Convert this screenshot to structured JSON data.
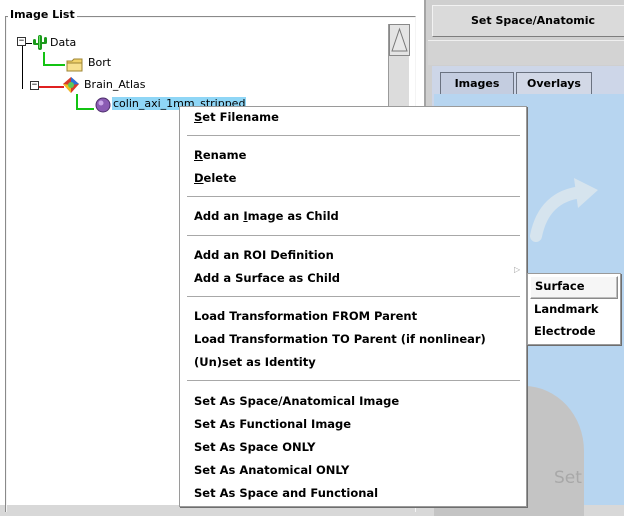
{
  "image_list": {
    "title": "Image List",
    "tree": {
      "root": "Data",
      "children": [
        {
          "label": "Bort"
        },
        {
          "label": "Brain_Atlas",
          "children": [
            {
              "label": "colin_axi_1mm_stripped"
            }
          ]
        }
      ]
    }
  },
  "right_panel": {
    "set_space_button": "Set Space/Anatomic",
    "tabs": [
      "Images",
      "Overlays"
    ],
    "viewer_text": "Set"
  },
  "context_menu": {
    "items": [
      {
        "label": "Set Filename",
        "accel": "S"
      },
      {
        "label": "Rename",
        "accel": "R"
      },
      {
        "label": "Delete",
        "accel": "D"
      },
      {
        "label": "Add an Image as Child",
        "accel": "I"
      },
      {
        "label": "Add an ROI Definition"
      },
      {
        "label": "Add a Surface as Child"
      },
      {
        "label": "Load Transformation FROM Parent"
      },
      {
        "label": "Load Transformation TO Parent (if nonlinear)"
      },
      {
        "label": "(Un)set as Identity"
      },
      {
        "label": "Set As Space/Anatomical Image"
      },
      {
        "label": "Set As Functional Image"
      },
      {
        "label": "Set As Space ONLY"
      },
      {
        "label": "Set As Anatomical ONLY"
      },
      {
        "label": "Set As Space and Functional"
      }
    ]
  },
  "submenu": {
    "items": [
      "Surface",
      "Landmark",
      "Electrode"
    ]
  },
  "icons": {
    "data_icon": "cactus-icon",
    "folder_icon": "folder-icon",
    "atlas_icon": "brain-atlas-icon",
    "image_icon": "brain-image-icon"
  },
  "colors": {
    "selection": "#8fd6f6",
    "viewer_bg": "#b7d5f0",
    "tree_green": "#13c313",
    "tree_red": "#e02020"
  }
}
